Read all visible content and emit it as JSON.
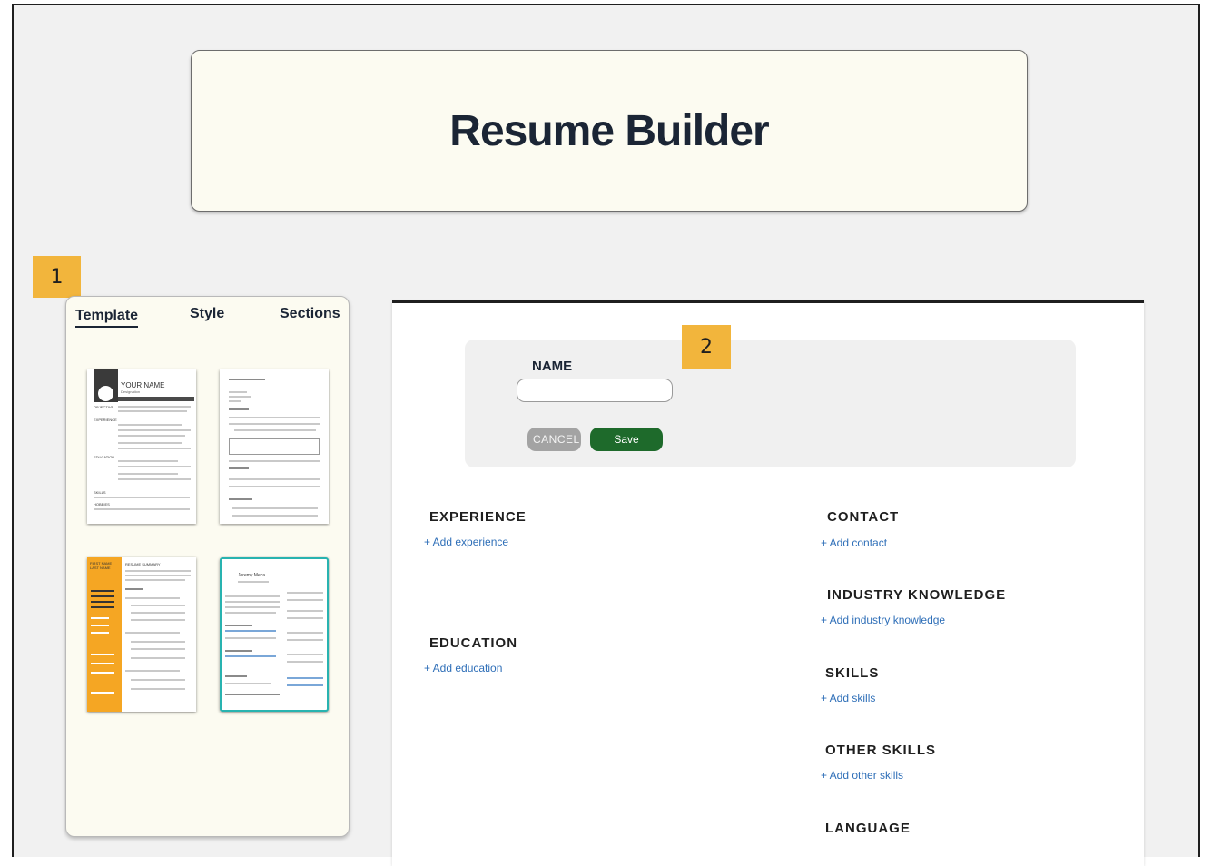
{
  "header": {
    "title": "Resume Builder"
  },
  "badges": {
    "left": "1",
    "form": "2"
  },
  "tabs": [
    {
      "label": "Template",
      "active": true
    },
    {
      "label": "Style",
      "active": false
    },
    {
      "label": "Sections",
      "active": false
    }
  ],
  "template_previews": {
    "tpl1": {
      "name": "YOUR NAME",
      "designation": "Designation",
      "sections": [
        "OBJECTIVE",
        "EXPERIENCE",
        "EDUCATION",
        "SKILLS",
        "HOBBIES"
      ]
    },
    "tpl3": {
      "name": "FIRST NAME LAST NAME",
      "summary": "RESUME SUMMARY"
    },
    "tpl4": {
      "name": "Jeremy Meca"
    }
  },
  "name_form": {
    "label": "NAME",
    "value": "",
    "placeholder": "",
    "cancel_label": "CANCEL",
    "save_label": "Save"
  },
  "sections": {
    "experience": {
      "title": "EXPERIENCE",
      "add": "+ Add experience"
    },
    "education": {
      "title": "EDUCATION",
      "add": "+ Add education"
    },
    "contact": {
      "title": "CONTACT",
      "add": "+ Add contact"
    },
    "industry": {
      "title": "INDUSTRY KNOWLEDGE",
      "add": "+ Add industry knowledge"
    },
    "skills": {
      "title": "SKILLS",
      "add": "+ Add skills"
    },
    "other_skills": {
      "title": "OTHER SKILLS",
      "add": "+ Add other skills"
    },
    "language": {
      "title": "LANGUAGE"
    }
  },
  "colors": {
    "accent_green": "#1e6a2b",
    "badge": "#f2b53c",
    "link": "#2f6fb8",
    "title": "#1b2535",
    "template_orange": "#f5a623",
    "template_teal": "#28b3b0"
  }
}
